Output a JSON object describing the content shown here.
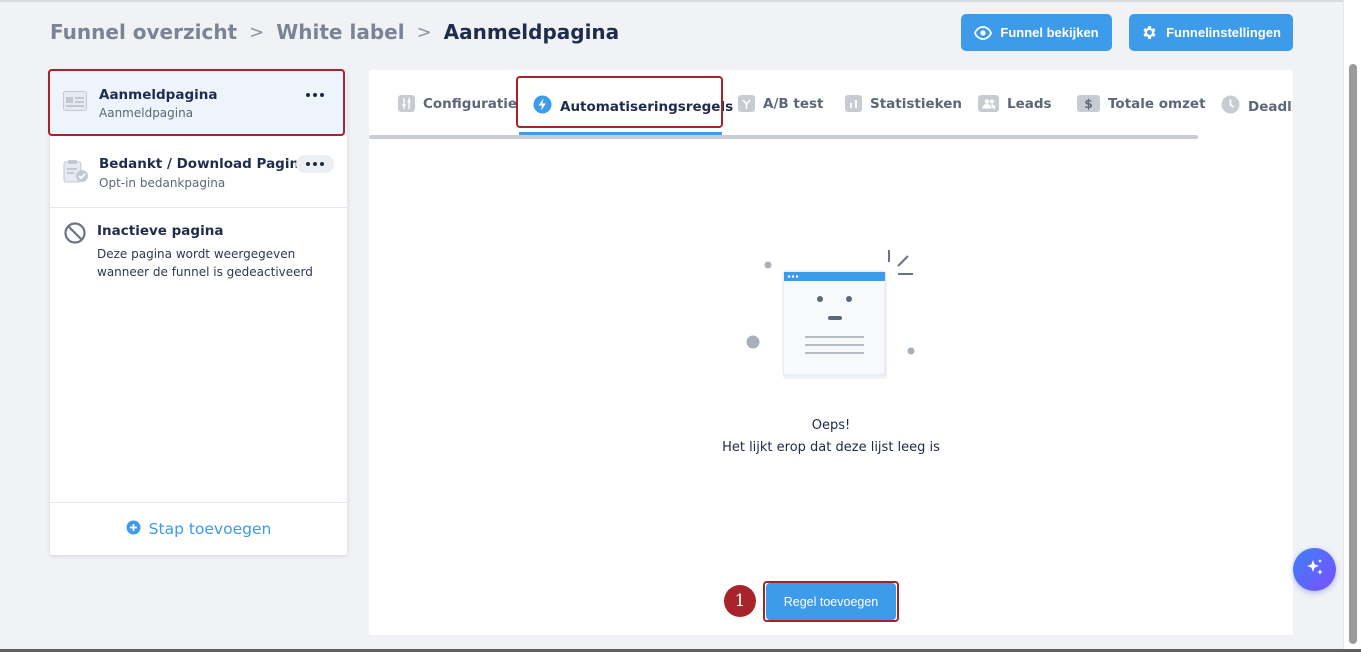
{
  "breadcrumb": {
    "items": [
      "Funnel overzicht",
      "White label"
    ],
    "current": "Aanmeldpagina",
    "separator": ">"
  },
  "header": {
    "view_button": "Funnel bekijken",
    "settings_button": "Funnelinstellingen"
  },
  "sidebar": {
    "items": [
      {
        "title": "Aanmeldpagina",
        "subtitle": "Aanmeldpagina",
        "selected": true,
        "icon": "landing-page-icon"
      },
      {
        "title": "Bedankt / Download Pagina",
        "subtitle": "Opt-in bedankpagina",
        "icon": "clipboard-check-icon"
      },
      {
        "title": "Inactieve pagina",
        "subtitle": "Deze pagina wordt weergegeven wanneer de funnel is gedeactiveerd",
        "icon": "ban-icon"
      }
    ],
    "footer_label": "Stap toevoegen"
  },
  "tabs": [
    {
      "label": "Configuratie",
      "icon": "sliders-icon"
    },
    {
      "label": "Automatiseringsregels",
      "icon": "bolt-icon",
      "active": true
    },
    {
      "label": "A/B test",
      "icon": "split-icon"
    },
    {
      "label": "Statistieken",
      "icon": "bar-chart-icon"
    },
    {
      "label": "Leads",
      "icon": "users-icon"
    },
    {
      "label": "Totale omzet",
      "icon": "dollar-icon"
    },
    {
      "label": "Deadlin",
      "icon": "clock-icon"
    }
  ],
  "empty_state": {
    "title": "Oeps!",
    "message": "Het lijkt erop dat deze lijst leeg is"
  },
  "actions": {
    "add_rule": "Regel toevoegen",
    "step_number": "1"
  },
  "colors": {
    "accent": "#3d9be9",
    "highlight_outline": "#a5232b",
    "background": "#f0f2f6"
  }
}
